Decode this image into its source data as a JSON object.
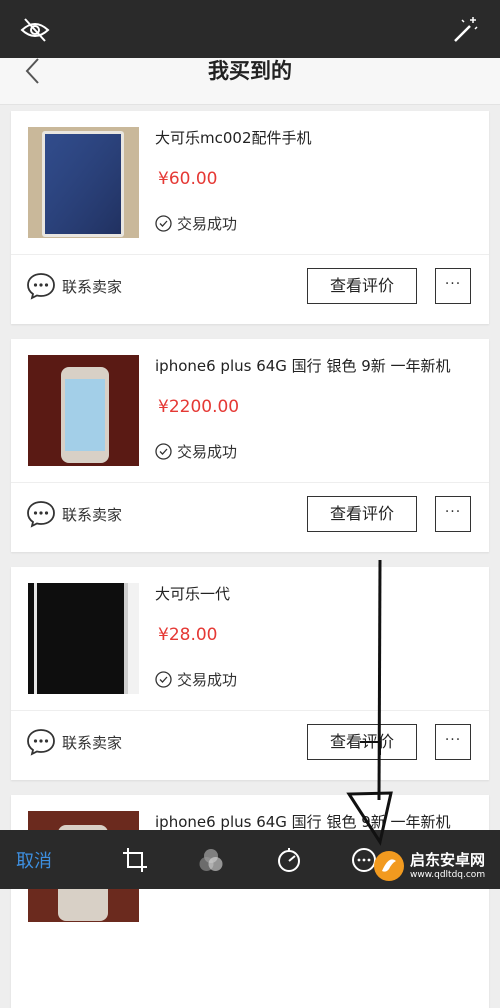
{
  "header": {
    "title": "我买到的",
    "hide_icon": "eye-off-icon",
    "magic_icon": "magic-wand-icon",
    "back_icon": "chevron-left-icon"
  },
  "colors": {
    "price": "#e53935",
    "cancel": "#3d8fe0",
    "toolbar_bg": "#2a2a2a"
  },
  "orders": [
    {
      "title": "大可乐mc002配件手机",
      "price": "¥60.00",
      "status": "交易成功",
      "contact": "联系卖家",
      "review": "查看评价",
      "more": "···"
    },
    {
      "title": "iphone6 plus 64G 国行 银色 9新 一年新机",
      "price": "¥2200.00",
      "status": "交易成功",
      "contact": "联系卖家",
      "review": "查看评价",
      "more": "···"
    },
    {
      "title": "大可乐一代",
      "price": "¥28.00",
      "status": "交易成功",
      "contact": "联系卖家",
      "review": "查看评价",
      "more": "···"
    },
    {
      "title": "iphone6 plus 64G 国行 银色 9新 一年新机"
    }
  ],
  "toolbar": {
    "cancel_label": "取消",
    "icons": [
      "crop-rotate-icon",
      "filters-icon",
      "adjust-icon",
      "more-tools-icon"
    ]
  },
  "watermark": {
    "name": "启东安卓网",
    "url": "www.qdltdq.com"
  }
}
